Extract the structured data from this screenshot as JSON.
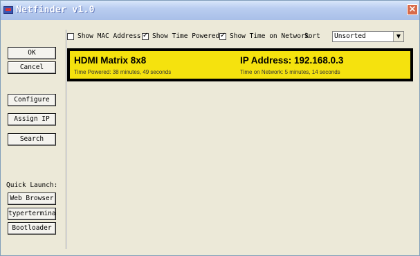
{
  "window": {
    "title": "Netfinder v1.0",
    "close_symbol": "×"
  },
  "sidebar": {
    "ok_label": "OK",
    "cancel_label": "Cancel",
    "configure_label": "Configure",
    "assign_ip_label": "Assign IP",
    "search_label": "Search",
    "quick_launch_label": "Quick Launch:",
    "web_browser_label": "Web Browser",
    "typerterminal_label": "typerterminal",
    "bootloader_label": "Bootloader"
  },
  "options": {
    "show_mac": {
      "label": "Show MAC Address",
      "checked": false
    },
    "show_time_powered": {
      "label": "Show Time Powered",
      "checked": true
    },
    "show_time_network": {
      "label": "Show Time on Network",
      "checked": true
    },
    "sort_label": "Sort",
    "sort_value": "Unsorted"
  },
  "devices": [
    {
      "name": "HDMI Matrix 8x8",
      "ip": "IP Address: 192.168.0.3",
      "time_powered": "Time Powered:  38 minutes, 49 seconds",
      "time_network": "Time on Network:  5 minutes, 14 seconds"
    }
  ],
  "colors": {
    "device_bg": "#f5e20e",
    "titlebar": "#b9cdf0"
  }
}
